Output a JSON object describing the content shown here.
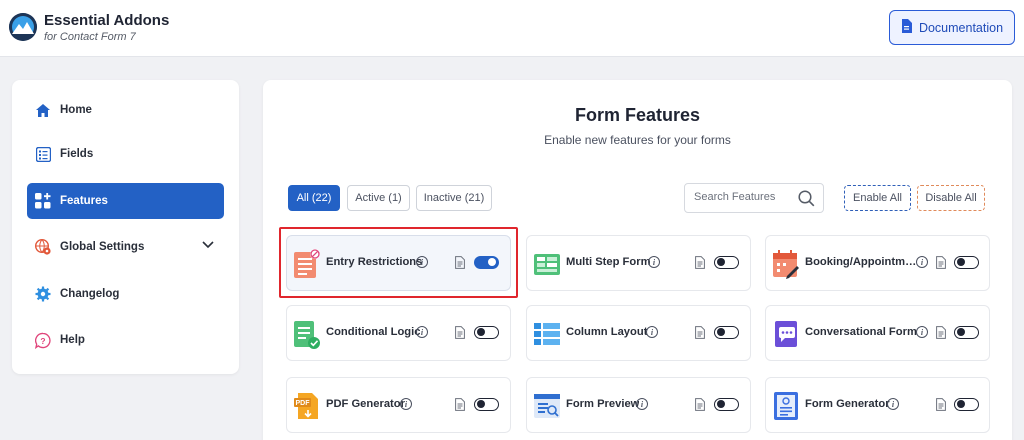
{
  "header": {
    "title": "Essential Addons",
    "subtitle": "for Contact Form 7",
    "doc_label": "Documentation"
  },
  "sidebar": {
    "items": [
      {
        "label": "Home",
        "icon": "home-icon"
      },
      {
        "label": "Fields",
        "icon": "fields-icon"
      },
      {
        "label": "Features",
        "icon": "features-icon",
        "active": true
      },
      {
        "label": "Global Settings",
        "icon": "global-settings-icon"
      },
      {
        "label": "Changelog",
        "icon": "changelog-icon"
      },
      {
        "label": "Help",
        "icon": "help-icon"
      }
    ]
  },
  "main": {
    "title": "Form Features",
    "subtitle": "Enable new features for your forms",
    "tabs": [
      {
        "label": "All (22)",
        "active": true
      },
      {
        "label": "Active (1)"
      },
      {
        "label": "Inactive (21)"
      }
    ],
    "search_placeholder": "Search Features",
    "enable_all": "Enable All",
    "disable_all": "Disable All"
  },
  "features": [
    {
      "name": "Entry Restrictions",
      "enabled": true,
      "icon": "entry-restrictions-icon"
    },
    {
      "name": "Multi Step Form",
      "enabled": false,
      "icon": "multi-step-form-icon"
    },
    {
      "name": "Booking/Appointment",
      "enabled": false,
      "icon": "booking-icon"
    },
    {
      "name": "Conditional Logic",
      "enabled": false,
      "icon": "conditional-logic-icon"
    },
    {
      "name": "Column Layout",
      "enabled": false,
      "icon": "column-layout-icon"
    },
    {
      "name": "Conversational Form",
      "enabled": false,
      "icon": "conversational-form-icon"
    },
    {
      "name": "PDF Generator",
      "enabled": false,
      "icon": "pdf-generator-icon"
    },
    {
      "name": "Form Preview",
      "enabled": false,
      "icon": "form-preview-icon"
    },
    {
      "name": "Form Generator",
      "enabled": false,
      "icon": "form-generator-icon"
    }
  ],
  "colors": {
    "accent": "#2361c5",
    "enable_all_border": "#2f5fb8",
    "disable_all_border": "#e08a5a",
    "highlight_box": "#e0262d"
  }
}
